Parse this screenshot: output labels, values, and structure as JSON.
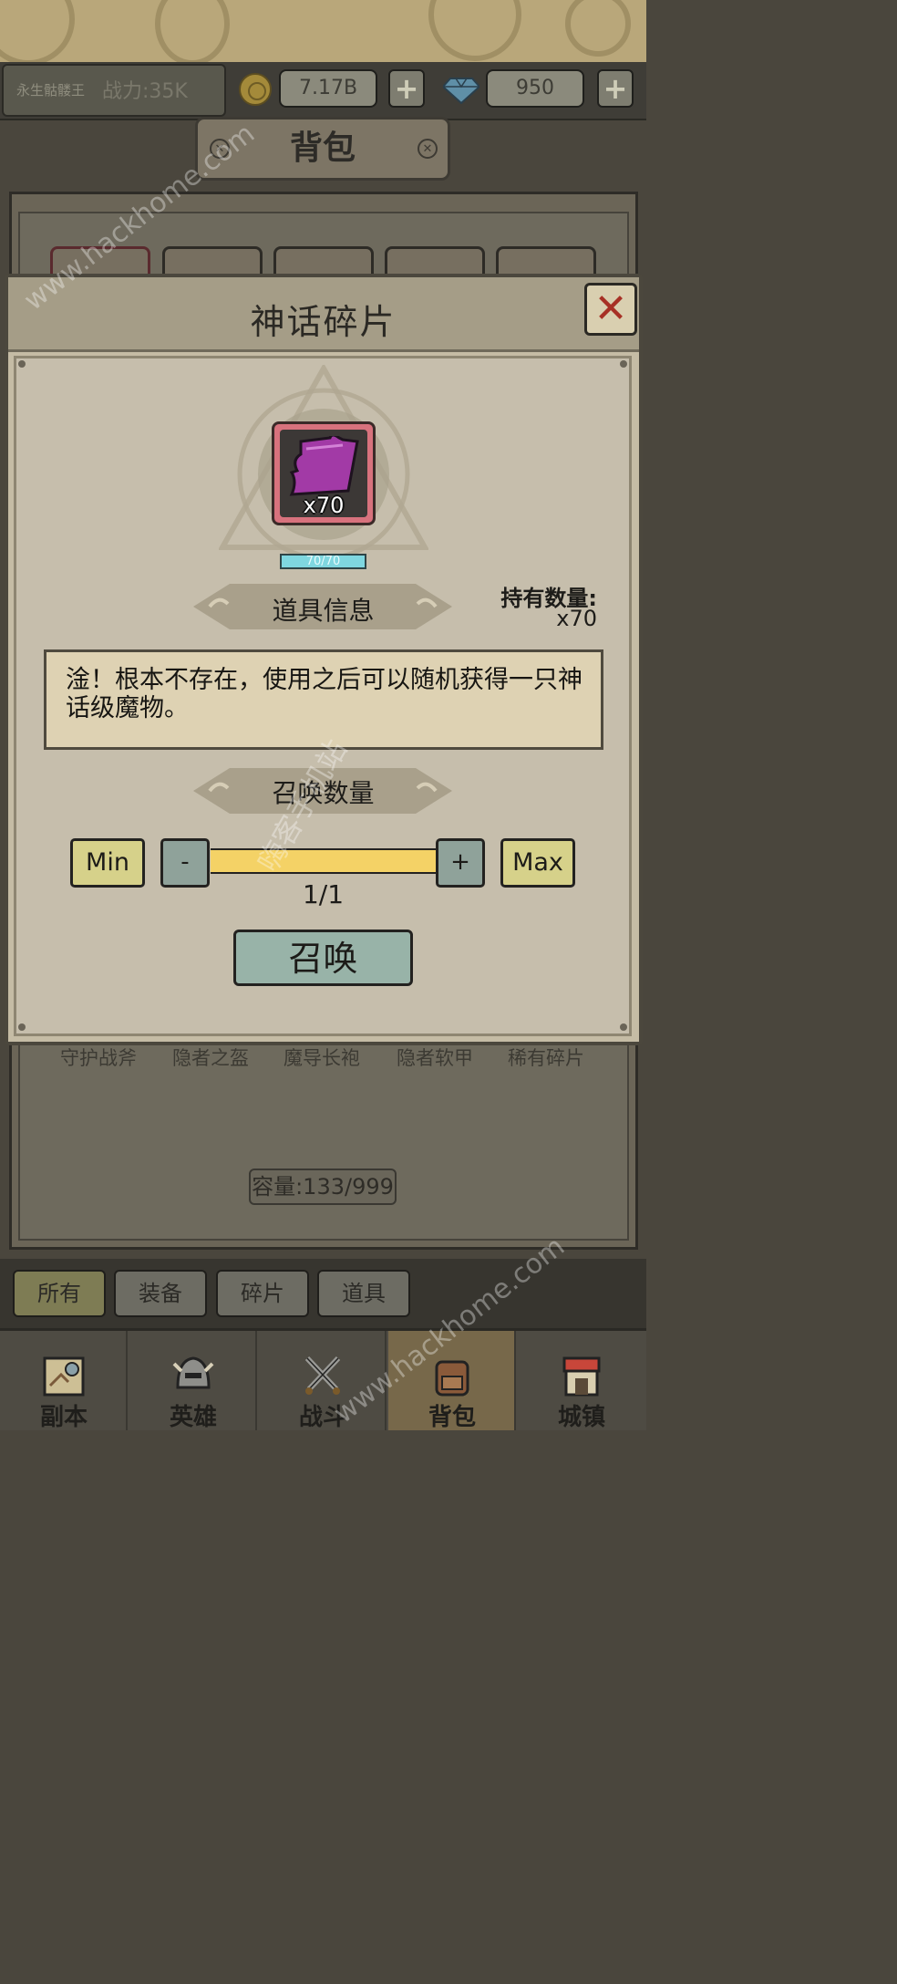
{
  "hud": {
    "player_name": "永生骷髅王",
    "power": "战力:35K",
    "gold": "7.17B",
    "gems": "950",
    "plus": "+"
  },
  "bag": {
    "title": "背包",
    "item_labels": [
      "守护战斧",
      "隐者之盔",
      "魔导长袍",
      "隐者软甲",
      "稀有碎片"
    ],
    "capacity": "容量:133/999"
  },
  "filters": [
    "所有",
    "装备",
    "碎片",
    "道具"
  ],
  "nav": [
    "副本",
    "英雄",
    "战斗",
    "背包",
    "城镇"
  ],
  "modal": {
    "title": "神话碎片",
    "close": "✕",
    "item_count": "x70",
    "progress_text": "70/70",
    "progress_fraction": 1.0,
    "info_header": "道具信息",
    "hold_label": "持有数量:",
    "hold_value": "x70",
    "description": "淦！根本不存在，使用之后可以随机获得一只神话级魔物。",
    "summon_count_header": "召唤数量",
    "min_label": "Min",
    "max_label": "Max",
    "minus_label": "-",
    "plus_label": "+",
    "quantity": "1/1",
    "summon_button": "召唤"
  },
  "watermark": {
    "site": "www.hackhome.com",
    "cn": "嗨客手机站"
  },
  "colors": {
    "accent_close": "#a73025",
    "item_border": "#d8727d",
    "progress": "#7fd7e0",
    "slider": "#f4d266",
    "summon_button": "#98b3a8"
  }
}
